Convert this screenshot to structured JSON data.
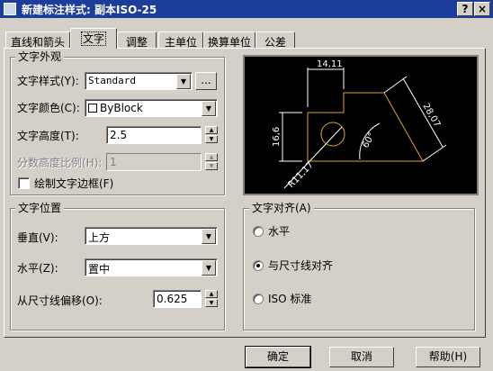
{
  "window": {
    "title": "新建标注样式: 副本ISO-25",
    "help_button": "?",
    "close_button": "×"
  },
  "tabs": [
    {
      "label": "直线和箭头"
    },
    {
      "label": "文字"
    },
    {
      "label": "调整"
    },
    {
      "label": "主单位"
    },
    {
      "label": "换算单位"
    },
    {
      "label": "公差"
    }
  ],
  "text_appearance": {
    "group_label": "文字外观",
    "text_style_label": "文字样式(Y):",
    "text_style_value": "Standard",
    "browse_button": "...",
    "text_color_label": "文字颜色(C):",
    "text_color_value": "ByBlock",
    "text_height_label": "文字高度(T):",
    "text_height_value": "2.5",
    "fraction_scale_label": "分数高度比例(H):",
    "fraction_scale_value": "1",
    "draw_frame_label": "绘制文字边框(F)"
  },
  "text_placement": {
    "group_label": "文字位置",
    "vertical_label": "垂直(V):",
    "vertical_value": "上方",
    "horizontal_label": "水平(Z):",
    "horizontal_value": "置中",
    "offset_label": "从尺寸线偏移(O):",
    "offset_value": "0.625"
  },
  "text_alignment": {
    "group_label": "文字对齐(A)",
    "options": [
      {
        "label": "水平",
        "checked": false
      },
      {
        "label": "与尺寸线对齐",
        "checked": true
      },
      {
        "label": "ISO 标准",
        "checked": false
      }
    ]
  },
  "preview": {
    "dims": [
      "14,11",
      "16,6",
      "28,07",
      "60°",
      "R11,17"
    ],
    "colors": {
      "geometry": "#e0a030",
      "dimension": "#ffffff",
      "background": "#000000"
    }
  },
  "buttons": {
    "ok": "确定",
    "cancel": "取消",
    "help": "帮助(H)"
  }
}
